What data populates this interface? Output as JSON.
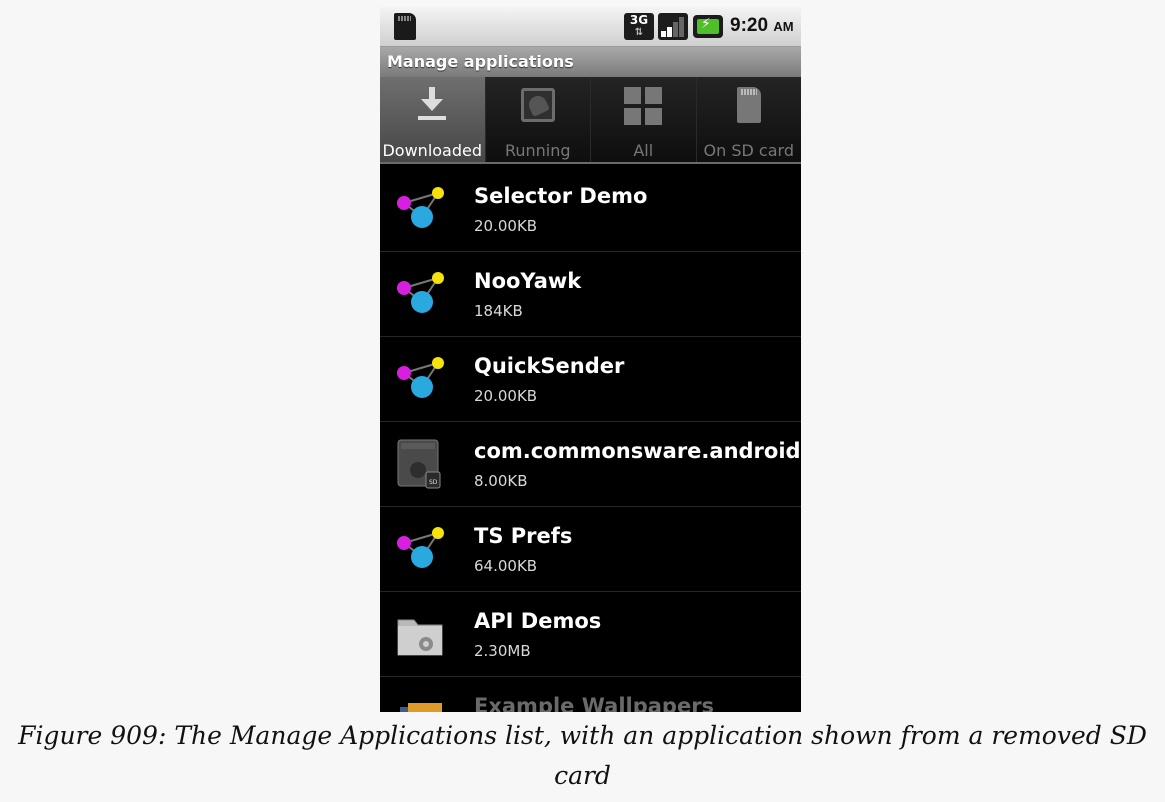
{
  "status_bar": {
    "network_type": "3G",
    "time": "9:20",
    "ampm": "AM",
    "icons": [
      "sd-card-icon",
      "3g-data-icon",
      "signal-strength-icon",
      "battery-charging-icon"
    ]
  },
  "title_bar": {
    "title": "Manage applications"
  },
  "tabs": [
    {
      "label": "Downloaded",
      "icon": "download-icon",
      "selected": true
    },
    {
      "label": "Running",
      "icon": "running-app-icon",
      "selected": false
    },
    {
      "label": "All",
      "icon": "grid-icon",
      "selected": false
    },
    {
      "label": "On SD card",
      "icon": "sd-card-icon",
      "selected": false
    }
  ],
  "apps": [
    {
      "name": "Selector Demo",
      "size": "20.00KB",
      "icon": "molecule-icon"
    },
    {
      "name": "NooYawk",
      "size": "184KB",
      "icon": "molecule-icon"
    },
    {
      "name": "QuickSender",
      "size": "20.00KB",
      "icon": "molecule-icon"
    },
    {
      "name": "com.commonsware.android",
      "size": "8.00KB",
      "icon": "android-sd-icon"
    },
    {
      "name": "TS Prefs",
      "size": "64.00KB",
      "icon": "molecule-icon"
    },
    {
      "name": "API Demos",
      "size": "2.30MB",
      "icon": "folder-gear-icon"
    },
    {
      "name": "Example Wallpapers",
      "size": "",
      "icon": "wallpaper-icon"
    }
  ],
  "caption": "Figure 909: The Manage Applications list, with an application shown from a removed SD card",
  "colors": {
    "list_background": "#000000",
    "title_bar": "#8f8f8f",
    "tab_selected": "#5a5a5a",
    "molecule_magenta": "#d81ee0",
    "molecule_cyan": "#2aa8e0",
    "molecule_yellow": "#f5e20a"
  }
}
